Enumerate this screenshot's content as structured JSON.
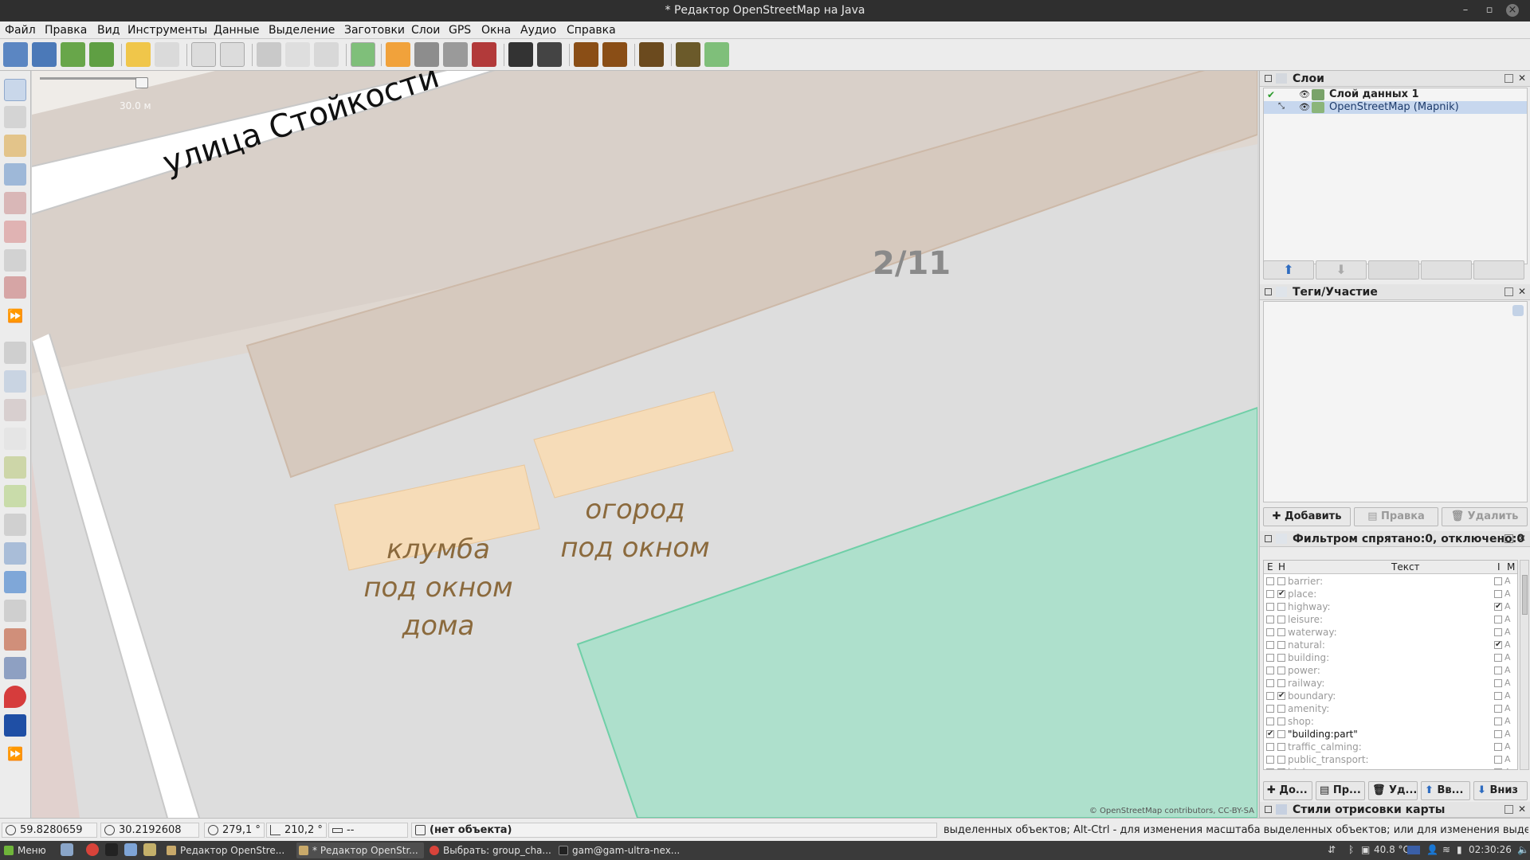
{
  "window": {
    "title": "* Редактор OpenStreetMap на Java"
  },
  "menu": [
    "Файл",
    "Правка",
    "Вид",
    "Инструменты",
    "Данные",
    "Выделение",
    "Заготовки",
    "Слои",
    "GPS",
    "Окна",
    "Аудио",
    "Справка"
  ],
  "map": {
    "street_label": "улица Стойкости",
    "house_number": "2/11",
    "area1_label": [
      "клумба",
      "под окном",
      "дома"
    ],
    "area2_label": [
      "огород",
      "под окном"
    ],
    "scale_text": "30.0 м",
    "attribution": "© OpenStreetMap contributors, CC-BY-SA"
  },
  "layers_panel": {
    "title": "Слои",
    "items": [
      {
        "name": "Слой данных 1",
        "bold": true
      },
      {
        "name": "OpenStreetMap (Mapnik)",
        "selected": true
      }
    ]
  },
  "tags_panel": {
    "title": "Теги/Участие",
    "buttons": {
      "add": "Добавить",
      "edit": "Правка",
      "delete": "Удалить"
    }
  },
  "filter_panel": {
    "title": "Фильтром спрятано:0, отключено:0",
    "columns": {
      "e": "E",
      "h": "H",
      "text": "Текст",
      "i": "I",
      "m": "M"
    },
    "rows": [
      {
        "e": false,
        "h": false,
        "text": "barrier:",
        "i": false,
        "m": "A"
      },
      {
        "e": false,
        "h": true,
        "text": "place:",
        "i": false,
        "m": "A"
      },
      {
        "e": false,
        "h": false,
        "text": "highway:",
        "i": true,
        "m": "A"
      },
      {
        "e": false,
        "h": false,
        "text": "leisure:",
        "i": false,
        "m": "A"
      },
      {
        "e": false,
        "h": false,
        "text": "waterway:",
        "i": false,
        "m": "A"
      },
      {
        "e": false,
        "h": false,
        "text": "natural:",
        "i": true,
        "m": "A"
      },
      {
        "e": false,
        "h": false,
        "text": "building:",
        "i": false,
        "m": "A"
      },
      {
        "e": false,
        "h": false,
        "text": "power:",
        "i": false,
        "m": "A"
      },
      {
        "e": false,
        "h": false,
        "text": "railway:",
        "i": false,
        "m": "A"
      },
      {
        "e": false,
        "h": true,
        "text": "boundary:",
        "i": false,
        "m": "A"
      },
      {
        "e": false,
        "h": false,
        "text": "amenity:",
        "i": false,
        "m": "A"
      },
      {
        "e": false,
        "h": false,
        "text": "shop:",
        "i": false,
        "m": "A"
      },
      {
        "e": true,
        "h": false,
        "text": "\"building:part\"",
        "i": false,
        "m": "A",
        "active": true
      },
      {
        "e": false,
        "h": false,
        "text": "traffic_calming:",
        "i": false,
        "m": "A"
      },
      {
        "e": false,
        "h": false,
        "text": "public_transport:",
        "i": false,
        "m": "A"
      },
      {
        "e": false,
        "h": true,
        "text": "highway:no",
        "i": false,
        "m": "A"
      }
    ],
    "buttons": [
      "До...",
      "Пр...",
      "Уд...",
      "Вв...",
      "Вниз"
    ]
  },
  "styles_panel": {
    "title": "Стили отрисовки карты"
  },
  "status": {
    "lat": "59.8280659",
    "lon": "30.2192608",
    "heading": "279,1 °",
    "angle": "210,2 °",
    "distance": "--",
    "object": "(нет объекта)",
    "message": "выделенных объектов; Alt-Ctrl - для изменения масштаба выделенных объектов; или для изменения выделения"
  },
  "taskbar": {
    "menu": "Меню",
    "tasks": [
      "Редактор OpenStre...",
      "* Редактор OpenStr...",
      "Выбрать: group_cha...",
      "gam@gam-ultra-nex..."
    ],
    "temperature": "40.8 °C",
    "time": "02:30:26"
  },
  "colors": {
    "grass": "#aee0cc",
    "building": "#d9d0c9",
    "garden": "#f6dcb8",
    "road": "#ffffff",
    "selection": "#c7d7ee"
  }
}
